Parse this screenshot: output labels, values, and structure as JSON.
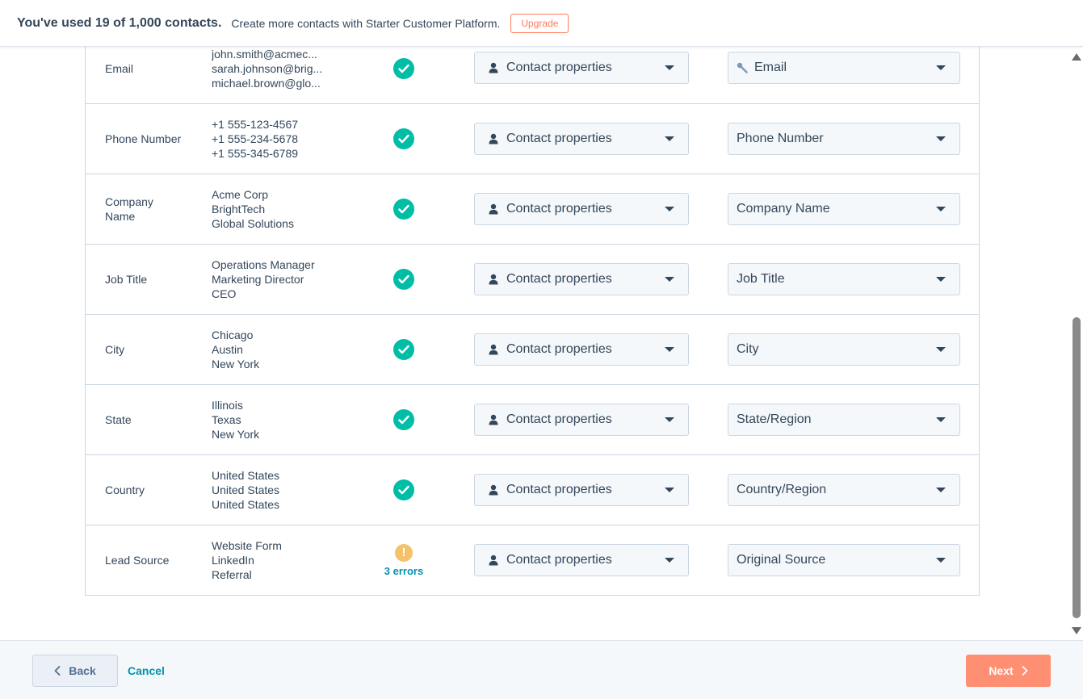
{
  "banner": {
    "usage_text": "You've used 19 of 1,000 contacts.",
    "promo_text": "Create more contacts with Starter Customer Platform.",
    "upgrade_label": "Upgrade"
  },
  "rows": [
    {
      "name": "Email",
      "samples": [
        "john.smith@acmec...",
        "sarah.johnson@brig...",
        "michael.brown@glo..."
      ],
      "status": "ok",
      "object_type": "Contact properties",
      "property": "Email",
      "property_icon": "key-icon"
    },
    {
      "name": "Phone Number",
      "samples": [
        "+1 555-123-4567",
        "+1 555-234-5678",
        "+1 555-345-6789"
      ],
      "status": "ok",
      "object_type": "Contact properties",
      "property": "Phone Number"
    },
    {
      "name": "Company Name",
      "samples": [
        "Acme Corp",
        "BrightTech",
        "Global Solutions"
      ],
      "status": "ok",
      "object_type": "Contact properties",
      "property": "Company Name"
    },
    {
      "name": "Job Title",
      "samples": [
        "Operations Manager",
        "Marketing Director",
        "CEO"
      ],
      "status": "ok",
      "object_type": "Contact properties",
      "property": "Job Title"
    },
    {
      "name": "City",
      "samples": [
        "Chicago",
        "Austin",
        "New York"
      ],
      "status": "ok",
      "object_type": "Contact properties",
      "property": "City"
    },
    {
      "name": "State",
      "samples": [
        "Illinois",
        "Texas",
        "New York"
      ],
      "status": "ok",
      "object_type": "Contact properties",
      "property": "State/Region"
    },
    {
      "name": "Country",
      "samples": [
        "United States",
        "United States",
        "United States"
      ],
      "status": "ok",
      "object_type": "Contact properties",
      "property": "Country/Region"
    },
    {
      "name": "Lead Source",
      "samples": [
        "Website Form",
        "LinkedIn",
        "Referral"
      ],
      "status": "error",
      "errors_label": "3 errors",
      "object_type": "Contact properties",
      "property": "Original Source"
    }
  ],
  "footer": {
    "back_label": "Back",
    "cancel_label": "Cancel",
    "next_label": "Next"
  },
  "colors": {
    "accent": "#ff7a59",
    "success": "#00bda5",
    "warning": "#f5c26b",
    "link": "#0091ae"
  }
}
